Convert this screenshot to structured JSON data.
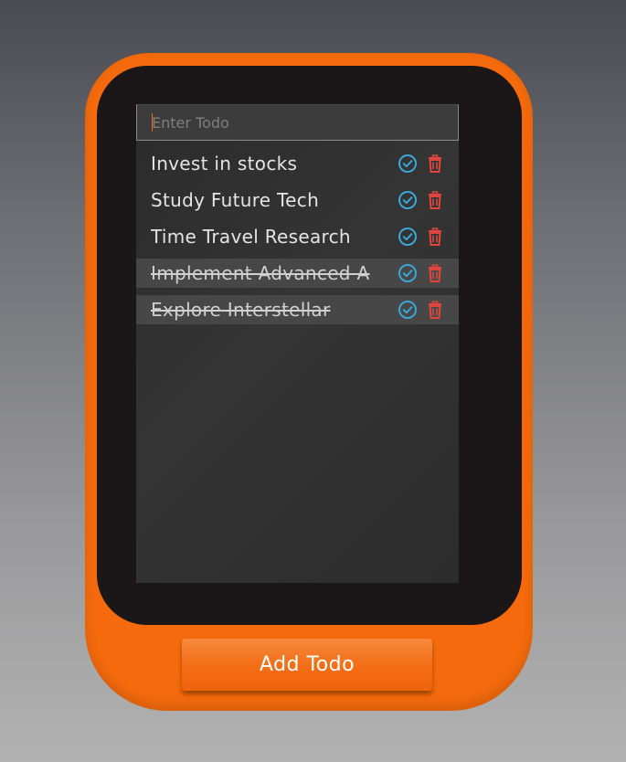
{
  "input": {
    "placeholder": "Enter Todo",
    "value": ""
  },
  "todos": [
    {
      "text": "Invest in stocks",
      "completed": false
    },
    {
      "text": "Study Future Tech",
      "completed": false
    },
    {
      "text": "Time Travel Research",
      "completed": false
    },
    {
      "text": "Implement Advanced A",
      "completed": true
    },
    {
      "text": "Explore Interstellar",
      "completed": true
    }
  ],
  "icons": {
    "complete": "check-circle-icon",
    "delete": "trash-icon"
  },
  "add_button": {
    "label": "Add Todo"
  },
  "colors": {
    "accent": "#f46a0c",
    "check": "#3ba6d9",
    "delete": "#e0463e",
    "completed_row": "#474747"
  }
}
